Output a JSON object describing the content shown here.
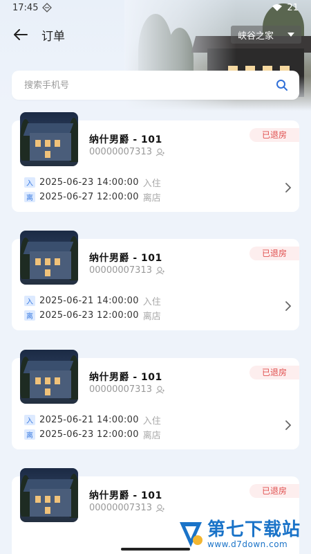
{
  "status_bar": {
    "time": "17:45",
    "battery": "21"
  },
  "header": {
    "title": "订单",
    "store_selector": "峡谷之家"
  },
  "search": {
    "placeholder": "搜索手机号"
  },
  "orders": [
    {
      "name": "纳什男爵 - 101",
      "order_no": "00000007313",
      "status": "已退房",
      "check_in_tag": "入",
      "check_in": "2025-06-23 14:00:00",
      "check_in_label": "入住",
      "check_out_tag": "离",
      "check_out": "2025-06-27 12:00:00",
      "check_out_label": "离店"
    },
    {
      "name": "纳什男爵 - 101",
      "order_no": "00000007313",
      "status": "已退房",
      "check_in_tag": "入",
      "check_in": "2025-06-21 14:00:00",
      "check_in_label": "入住",
      "check_out_tag": "离",
      "check_out": "2025-06-23 12:00:00",
      "check_out_label": "离店"
    },
    {
      "name": "纳什男爵 - 101",
      "order_no": "00000007313",
      "status": "已退房",
      "check_in_tag": "入",
      "check_in": "2025-06-21 14:00:00",
      "check_in_label": "入住",
      "check_out_tag": "离",
      "check_out": "2025-06-23 12:00:00",
      "check_out_label": "离店"
    },
    {
      "name": "纳什男爵 - 101",
      "order_no": "00000007313",
      "status": "已退房"
    }
  ],
  "watermark": {
    "title": "第七下载站",
    "url": "www.d7down.com"
  },
  "colors": {
    "accent": "#3a7be0",
    "status_red": "#e0504f",
    "background": "#eef3fa"
  }
}
